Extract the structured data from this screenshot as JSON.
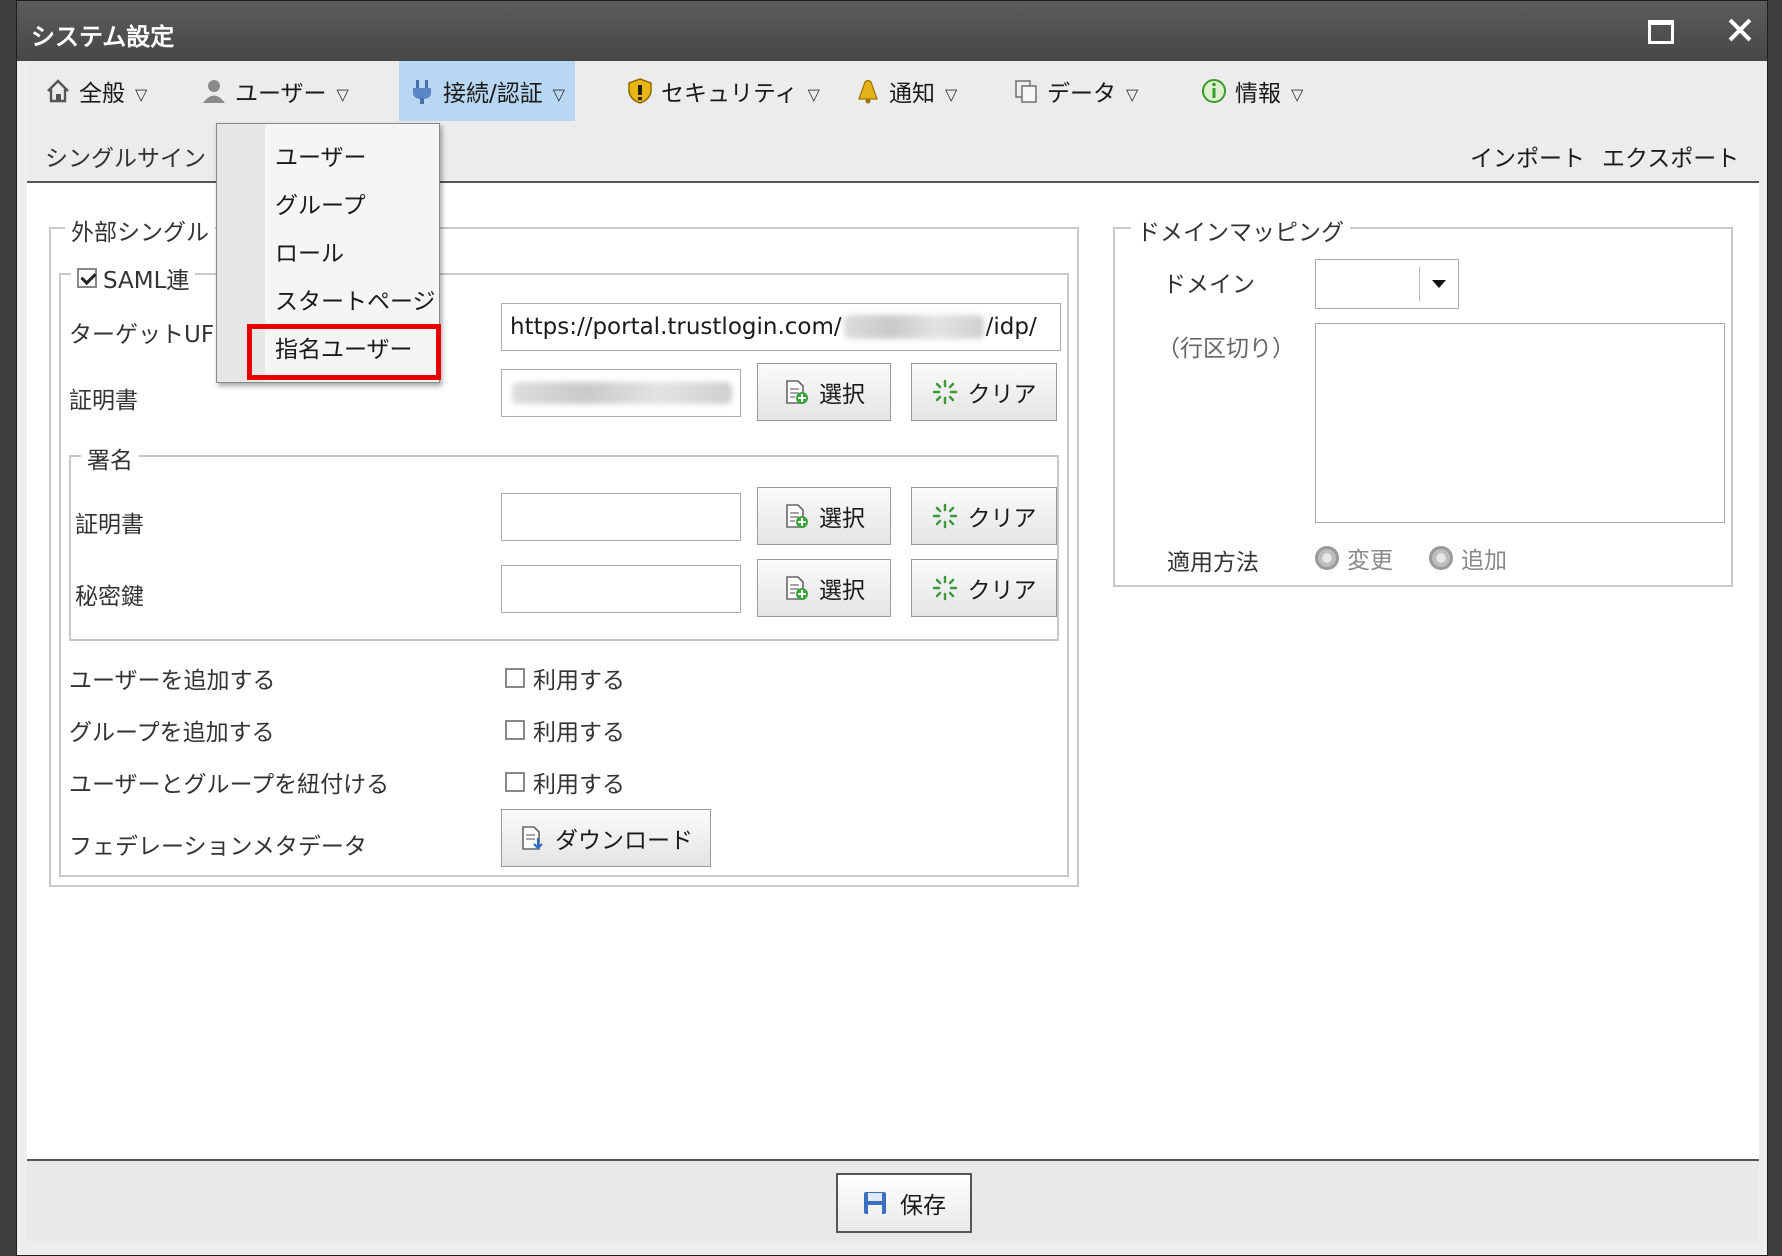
{
  "window": {
    "title": "システム設定"
  },
  "menubar": {
    "items": [
      {
        "label": "全般",
        "icon": "home-icon"
      },
      {
        "label": "ユーザー",
        "icon": "user-icon"
      },
      {
        "label": "接続/認証",
        "icon": "plug-icon"
      },
      {
        "label": "セキュリティ",
        "icon": "shield-icon"
      },
      {
        "label": "通知",
        "icon": "bell-icon"
      },
      {
        "label": "データ",
        "icon": "copy-icon"
      },
      {
        "label": "情報",
        "icon": "info-icon"
      }
    ],
    "active": "接続/認証"
  },
  "subbar": {
    "current": "シングルサイン",
    "import": "インポート",
    "export": "エクスポート"
  },
  "dropdown": {
    "items": [
      "ユーザー",
      "グループ",
      "ロール",
      "スタートページ",
      "指名ユーザー"
    ],
    "highlighted": "指名ユーザー"
  },
  "sso_panel": {
    "legend": "外部シングル",
    "saml_label": "SAML連",
    "saml_checked": true,
    "target_url_label": "ターゲットUF",
    "target_url_value": "https://portal.trustlogin.com/",
    "target_url_suffix": "/idp/",
    "cert_label": "証明書",
    "select_label": "選択",
    "clear_label": "クリア",
    "signature": {
      "legend": "署名",
      "cert_label": "証明書",
      "key_label": "秘密鍵"
    },
    "options": [
      {
        "label": "ユーザーを追加する",
        "check_label": "利用する",
        "checked": false
      },
      {
        "label": "グループを追加する",
        "check_label": "利用する",
        "checked": false
      },
      {
        "label": "ユーザーとグループを紐付ける",
        "check_label": "利用する",
        "checked": false
      }
    ],
    "federation_label": "フェデレーションメタデータ",
    "download_label": "ダウンロード"
  },
  "domain_panel": {
    "legend": "ドメインマッピング",
    "domain_label": "ドメイン",
    "domain_value": "",
    "linebreak_label": "（行区切り）",
    "apply_label": "適用方法",
    "apply_options": [
      "変更",
      "追加"
    ]
  },
  "footer": {
    "save_label": "保存"
  },
  "colors": {
    "titlebar": "#4f4f4f",
    "active_menu": "#b8d7f2",
    "highlight": "#e60000"
  }
}
